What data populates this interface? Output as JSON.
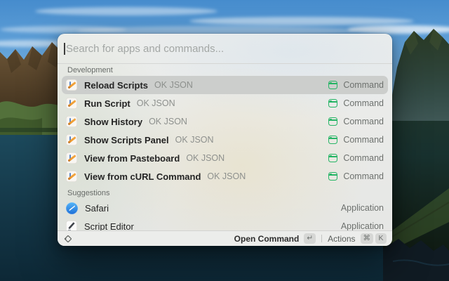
{
  "search": {
    "placeholder": "Search for apps and commands..."
  },
  "sections": [
    {
      "title": "Development",
      "items": [
        {
          "title": "Reload Scripts",
          "app": "OK JSON",
          "type": "Command",
          "selected": true
        },
        {
          "title": "Run Script",
          "app": "OK JSON",
          "type": "Command",
          "selected": false
        },
        {
          "title": "Show History",
          "app": "OK JSON",
          "type": "Command",
          "selected": false
        },
        {
          "title": "Show Scripts Panel",
          "app": "OK JSON",
          "type": "Command",
          "selected": false
        },
        {
          "title": "View from Pasteboard",
          "app": "OK JSON",
          "type": "Command",
          "selected": false
        },
        {
          "title": "View from cURL Command",
          "app": "OK JSON",
          "type": "Command",
          "selected": false
        }
      ]
    },
    {
      "title": "Suggestions",
      "items": [
        {
          "title": "Safari",
          "type": "Application"
        },
        {
          "title": "Script Editor",
          "type": "Application"
        }
      ]
    }
  ],
  "footer": {
    "primary_label": "Open Command",
    "primary_key": "↵",
    "actions_label": "Actions",
    "actions_keys": [
      "⌘",
      "K"
    ]
  },
  "colors": {
    "command_icon_green": "#27b566",
    "selection_gray": "#cccecc",
    "window_base": "#e9eae8"
  }
}
